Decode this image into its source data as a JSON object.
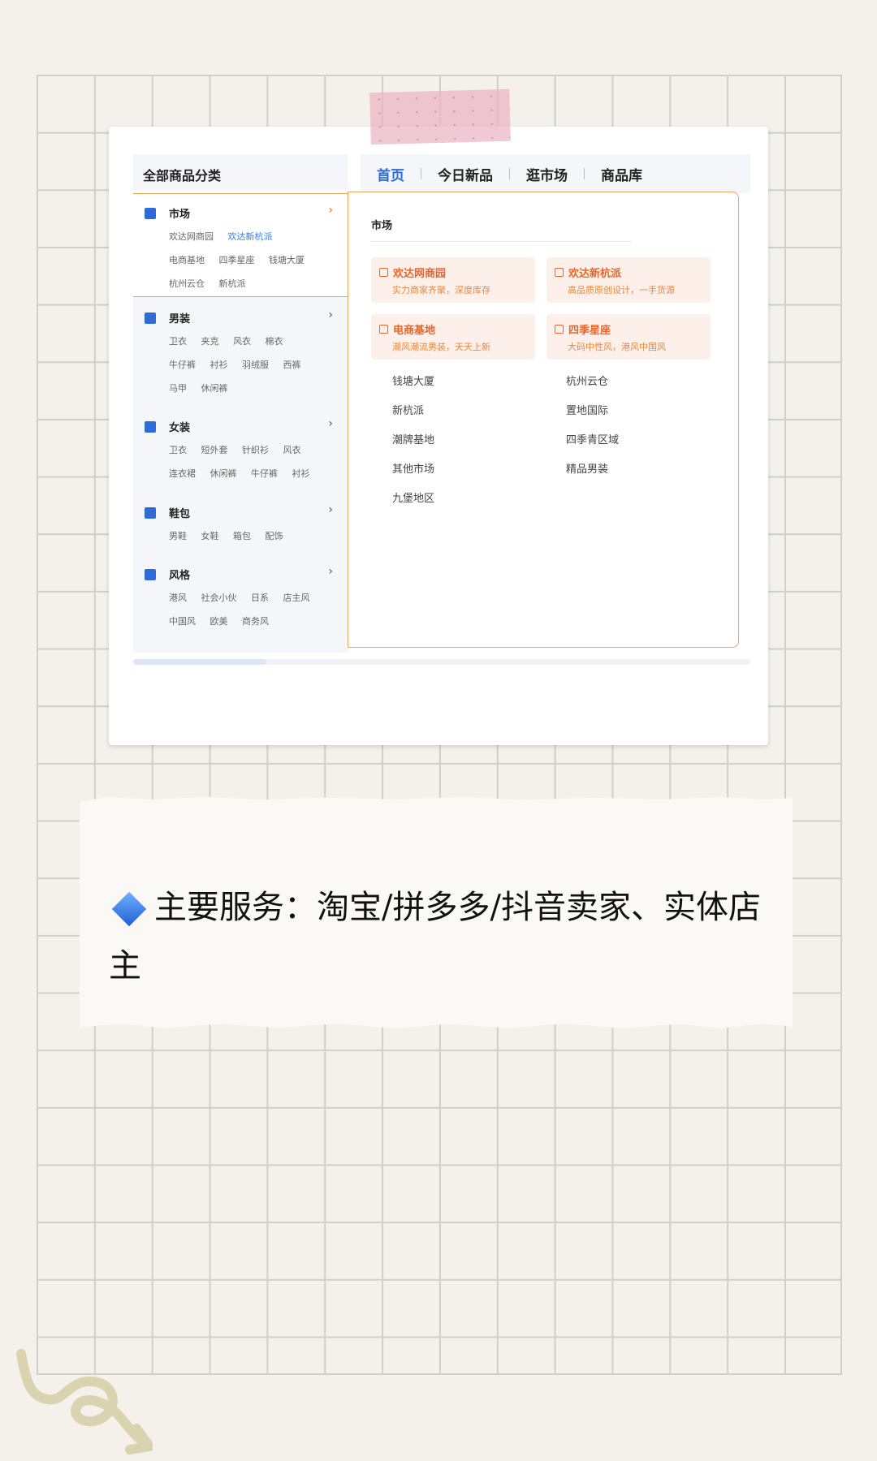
{
  "header": {
    "category_title": "全部商品分类"
  },
  "tabs": [
    {
      "label": "首页",
      "active": true
    },
    {
      "label": "今日新品"
    },
    {
      "label": "逛市场"
    },
    {
      "label": "商品库"
    }
  ],
  "sidebar": {
    "sections": [
      {
        "title": "市场",
        "icon": "building-icon",
        "rows": [
          [
            "欢达网商园",
            "欢达新杭派"
          ],
          [
            "电商基地",
            "四季星座",
            "钱塘大厦"
          ],
          [
            "杭州云仓",
            "新杭派"
          ]
        ]
      },
      {
        "title": "男装",
        "icon": "shirt-icon",
        "rows": [
          [
            "卫衣",
            "夹克",
            "风衣",
            "棉衣"
          ],
          [
            "牛仔裤",
            "衬衫",
            "羽绒服",
            "西裤"
          ],
          [
            "马甲",
            "休闲裤"
          ]
        ]
      },
      {
        "title": "女装",
        "icon": "dress-icon",
        "rows": [
          [
            "卫衣",
            "短外套",
            "针织衫",
            "风衣"
          ],
          [
            "连衣裙",
            "休闲裤",
            "牛仔裤",
            "衬衫"
          ]
        ]
      },
      {
        "title": "鞋包",
        "icon": "shoe-icon",
        "rows": [
          [
            "男鞋",
            "女鞋",
            "箱包",
            "配饰"
          ]
        ]
      },
      {
        "title": "风格",
        "icon": "bookmark-icon",
        "rows": [
          [
            "港风",
            "社会小伙",
            "日系",
            "店主风"
          ],
          [
            "中国风",
            "欧美",
            "商务风"
          ]
        ]
      }
    ]
  },
  "panel": {
    "title": "市场",
    "featured": [
      {
        "name": "欢达网商园",
        "desc": "实力商家齐聚，深度库存"
      },
      {
        "name": "欢达新杭派",
        "desc": "高品质原创设计，一手货源"
      },
      {
        "name": "电商基地",
        "desc": "潮风潮流男装，天天上新"
      },
      {
        "name": "四季星座",
        "desc": "大码中性风，港风中国风"
      }
    ],
    "list_left": [
      "钱塘大厦",
      "新杭派",
      "潮牌基地",
      "其他市场",
      "九堡地区"
    ],
    "list_right": [
      "杭州云仓",
      "置地国际",
      "四季青区域",
      "精品男装"
    ]
  },
  "note": {
    "text": "主要服务：淘宝/拼多多/抖音卖家、实体店主"
  },
  "colors": {
    "accent_blue": "#2f6bd8",
    "accent_orange": "#e8662a",
    "tape_pink": "#ebb4c3"
  }
}
